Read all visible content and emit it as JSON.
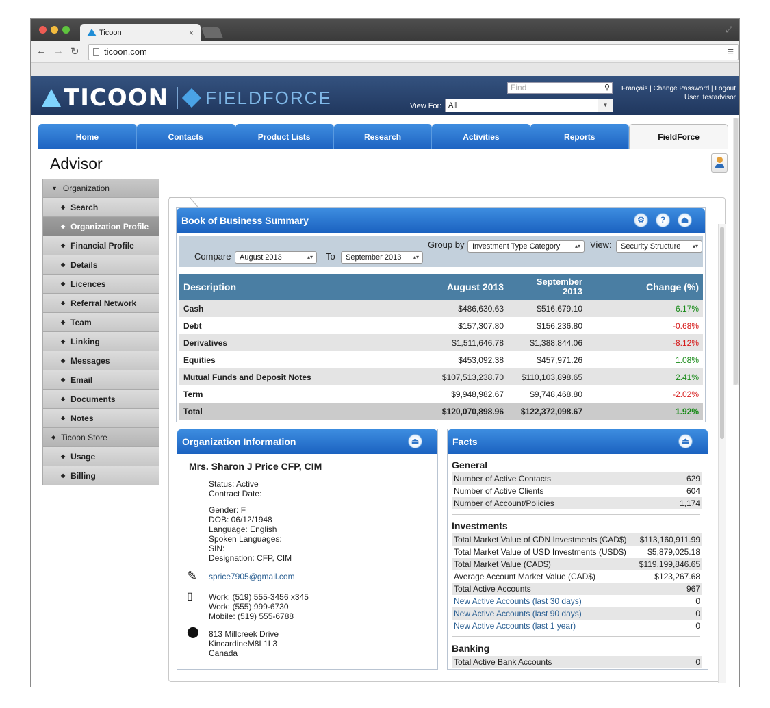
{
  "browser": {
    "tab_title": "Ticoon",
    "tab_close": "×",
    "url": "ticoon.com"
  },
  "header": {
    "logo_text": "TICOON",
    "product_text": "FIELDFORCE",
    "find_placeholder": "Find",
    "view_for_label": "View For:",
    "view_for_value": "All",
    "links": "Français | Change Password | Logout",
    "user_line": "User: testadvisor"
  },
  "nav": {
    "tabs": [
      "Home",
      "Contacts",
      "Product Lists",
      "Research",
      "Activities",
      "Reports",
      "FieldForce"
    ],
    "active": "FieldForce"
  },
  "page": {
    "title": "Advisor"
  },
  "sidebar": {
    "items": [
      {
        "label": "Organization",
        "type": "group-open"
      },
      {
        "label": "Search",
        "type": "sub"
      },
      {
        "label": "Organization Profile",
        "type": "sub",
        "selected": true
      },
      {
        "label": "Financial Profile",
        "type": "sub"
      },
      {
        "label": "Details",
        "type": "sub"
      },
      {
        "label": "Licences",
        "type": "sub"
      },
      {
        "label": "Referral Network",
        "type": "sub"
      },
      {
        "label": "Team",
        "type": "sub"
      },
      {
        "label": "Linking",
        "type": "sub"
      },
      {
        "label": "Messages",
        "type": "sub"
      },
      {
        "label": "Email",
        "type": "sub"
      },
      {
        "label": "Documents",
        "type": "sub"
      },
      {
        "label": "Notes",
        "type": "sub"
      },
      {
        "label": "Ticoon Store",
        "type": "group"
      },
      {
        "label": "Usage",
        "type": "sub"
      },
      {
        "label": "Billing",
        "type": "sub"
      }
    ]
  },
  "bob": {
    "title": "Book of Business Summary",
    "compare_label": "Compare",
    "compare_value": "August 2013",
    "to_label": "To",
    "to_value": "September 2013",
    "group_by_label": "Group by",
    "group_by_value": "Investment Type Category",
    "view_label": "View:",
    "view_value": "Security Structure",
    "columns": [
      "Description",
      "August 2013",
      "September 2013",
      "Change (%)"
    ],
    "rows": [
      {
        "desc": "Cash",
        "a": "$486,630.63",
        "b": "$516,679.10",
        "chg": "6.17%",
        "dir": "pos"
      },
      {
        "desc": "Debt",
        "a": "$157,307.80",
        "b": "$156,236.80",
        "chg": "-0.68%",
        "dir": "neg"
      },
      {
        "desc": "Derivatives",
        "a": "$1,511,646.78",
        "b": "$1,388,844.06",
        "chg": "-8.12%",
        "dir": "neg"
      },
      {
        "desc": "Equities",
        "a": "$453,092.38",
        "b": "$457,971.26",
        "chg": "1.08%",
        "dir": "pos"
      },
      {
        "desc": "Mutual Funds and Deposit Notes",
        "a": "$107,513,238.70",
        "b": "$110,103,898.65",
        "chg": "2.41%",
        "dir": "pos"
      },
      {
        "desc": "Term",
        "a": "$9,948,982.67",
        "b": "$9,748,468.80",
        "chg": "-2.02%",
        "dir": "neg"
      }
    ],
    "total": {
      "desc": "Total",
      "a": "$120,070,898.96",
      "b": "$122,372,098.67",
      "chg": "1.92%"
    }
  },
  "org": {
    "title": "Organization Information",
    "name": "Mrs. Sharon J Price CFP, CIM",
    "status_lines": [
      "Status: Active",
      "Contract Date:"
    ],
    "personal_lines": [
      "Gender: F",
      "DOB: 06/12/1948",
      "Language: English",
      "Spoken Languages:",
      "SIN:",
      "Designation: CFP, CIM"
    ],
    "email": "sprice7905@gmail.com",
    "phones": [
      "Work: (519) 555-3456 x345",
      "Work: (555) 999-6730",
      "Mobile: (519) 555-6788"
    ],
    "address": [
      "813 Millcreek Drive",
      "KincardineM8I 1L3",
      "Canada"
    ]
  },
  "facts": {
    "title": "Facts",
    "general_title": "General",
    "general": [
      {
        "label": "Number of Active Contacts",
        "value": "629"
      },
      {
        "label": "Number of Active Clients",
        "value": "604"
      },
      {
        "label": "Number of Account/Policies",
        "value": "1,174"
      }
    ],
    "investments_title": "Investments",
    "investments": [
      {
        "label": "Total Market Value of CDN Investments (CAD$)",
        "value": "$113,160,911.99"
      },
      {
        "label": "Total Market Value of USD Investments (USD$)",
        "value": "$5,879,025.18"
      },
      {
        "label": "Total Market Value (CAD$)",
        "value": "$119,199,846.65"
      },
      {
        "label": "Average Account Market Value (CAD$)",
        "value": "$123,267.68"
      },
      {
        "label": "Total Active Accounts",
        "value": "967"
      },
      {
        "label": "New Active Accounts (last 30 days)",
        "value": "0",
        "link": true
      },
      {
        "label": "New Active Accounts (last 90 days)",
        "value": "0",
        "link": true
      },
      {
        "label": "New Active Accounts (last 1 year)",
        "value": "0",
        "link": true
      }
    ],
    "banking_title": "Banking",
    "banking": [
      {
        "label": "Total Active Bank Accounts",
        "value": "0"
      }
    ]
  },
  "colors": {
    "header_bg": "#20375e",
    "tab_blue": "#1d63c1",
    "table_head": "#4a7ea3",
    "positive": "#178a17",
    "negative": "#d61a1a"
  }
}
